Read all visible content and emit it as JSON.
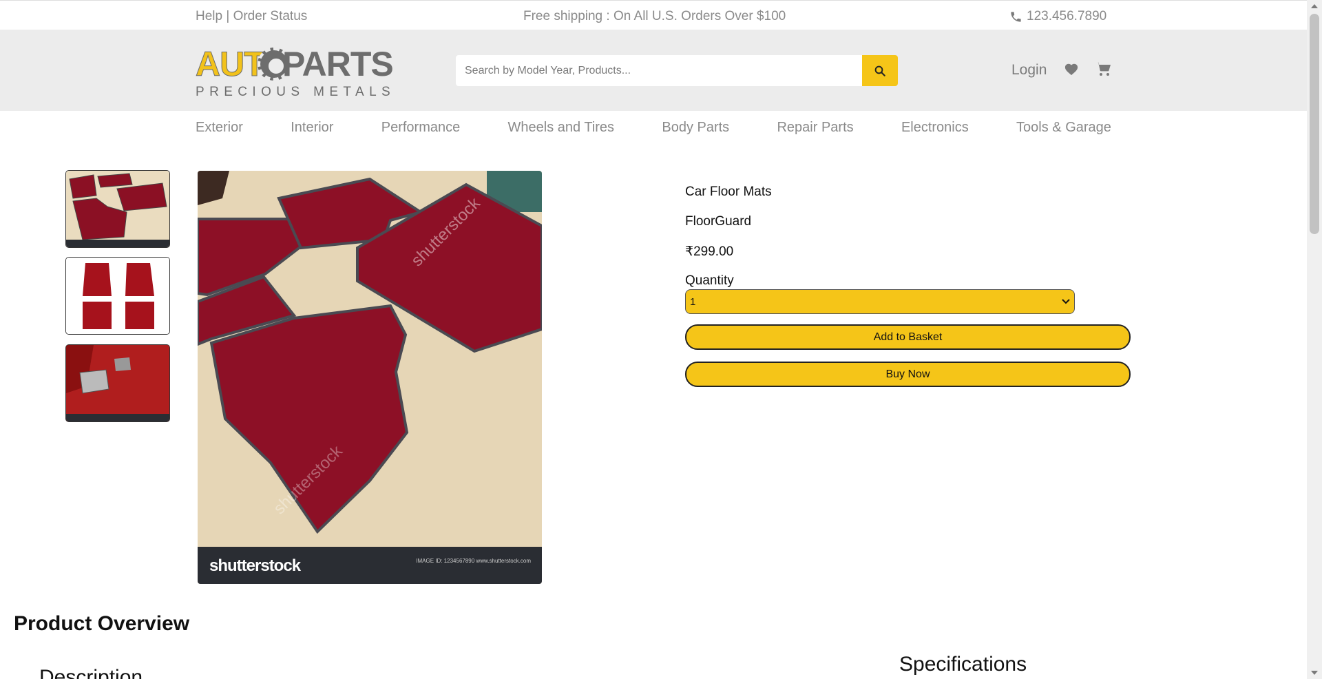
{
  "topbar": {
    "links": "Help | Order Status",
    "promo": "Free shipping : On All U.S. Orders Over $100",
    "phone": "123.456.7890"
  },
  "brand": {
    "logo_main_left": "AUT",
    "logo_main_right": "PARTS",
    "logo_sub": "PRECIOUS METALS",
    "accent_color": "#f5c518"
  },
  "search": {
    "placeholder": "Search by Model Year, Products...",
    "value": ""
  },
  "account": {
    "login_label": "Login"
  },
  "nav": {
    "items": [
      "Exterior",
      "Interior",
      "Performance",
      "Wheels and Tires",
      "Body Parts",
      "Repair Parts",
      "Electronics",
      "Tools & Garage"
    ]
  },
  "product": {
    "title": "Car Floor Mats",
    "brand": "FloorGuard",
    "price": "₹299.00",
    "quantity_label": "Quantity",
    "quantity_selected": "1",
    "add_to_basket_label": "Add to Basket",
    "buy_now_label": "Buy Now",
    "image_watermark": "shutterstock",
    "image_footer_text": "IMAGE ID: 1234567890 www.shutterstock.com"
  },
  "sections": {
    "overview_title": "Product Overview",
    "description_title": "Description",
    "specifications_title": "Specifications"
  },
  "icons": {
    "phone": "phone-icon",
    "search": "search-icon",
    "wishlist": "heart-icon",
    "cart": "cart-icon",
    "select_arrow": "chevron-down-icon"
  }
}
